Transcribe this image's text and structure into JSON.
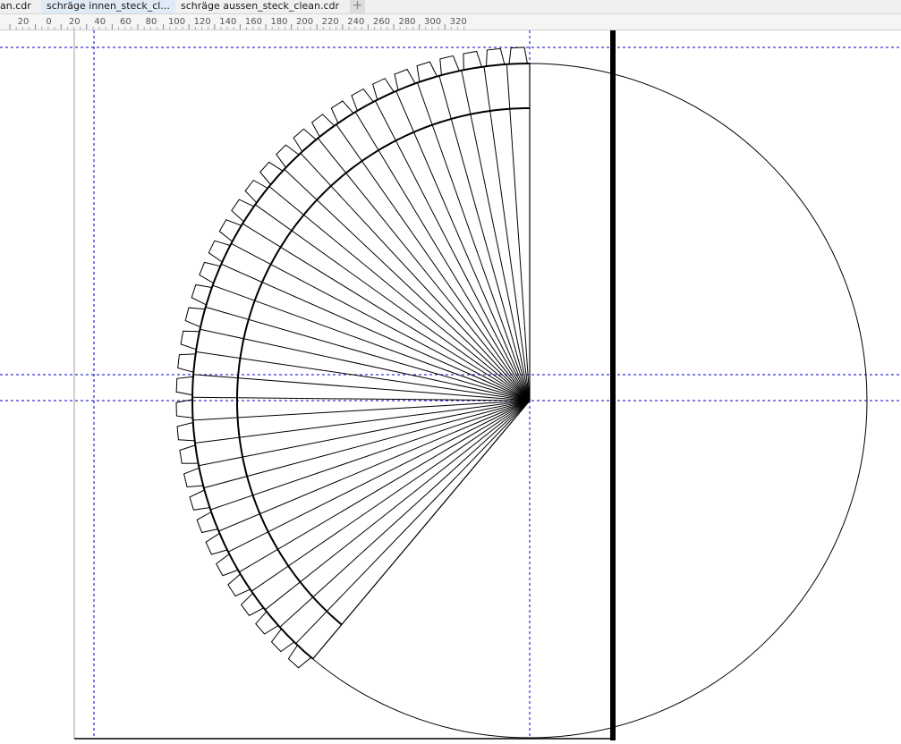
{
  "tabs": [
    {
      "label": "an.cdr"
    },
    {
      "label": "schräge innen_steck_cl..."
    },
    {
      "label": "schräge aussen_steck_clean.cdr"
    }
  ],
  "tab_add_label": "+",
  "ruler": {
    "labels": [
      "20",
      "0",
      "20",
      "40",
      "60",
      "80",
      "100",
      "120",
      "140",
      "160",
      "180",
      "200",
      "220",
      "240",
      "260",
      "280",
      "300",
      "320"
    ]
  },
  "colors": {
    "guide": "#0000cc",
    "line": "#000000",
    "active_tab": "#e0e9f6"
  },
  "drawing": {
    "segment_count": 36
  }
}
